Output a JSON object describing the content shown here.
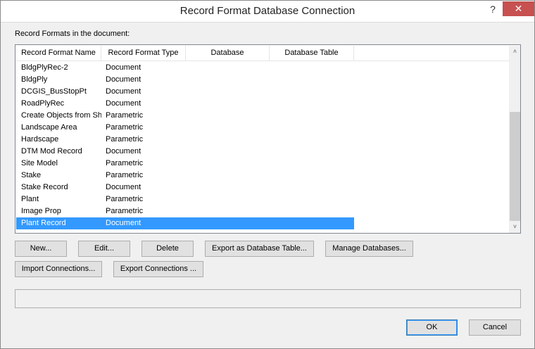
{
  "window": {
    "title": "Record Format Database Connection",
    "help_glyph": "?",
    "close_glyph": "✕"
  },
  "section_label": "Record Formats in the document:",
  "columns": [
    "Record Format Name",
    "Record Format Type",
    "Database",
    "Database Table"
  ],
  "rows": [
    {
      "name": "BldgPlyRec-2",
      "type": "Document",
      "database": "",
      "table": ""
    },
    {
      "name": "BldgPly",
      "type": "Document",
      "database": "",
      "table": ""
    },
    {
      "name": "DCGIS_BusStopPt",
      "type": "Document",
      "database": "",
      "table": ""
    },
    {
      "name": "RoadPlyRec",
      "type": "Document",
      "database": "",
      "table": ""
    },
    {
      "name": "Create Objects from Sh",
      "type": "Parametric",
      "database": "",
      "table": ""
    },
    {
      "name": "Landscape Area",
      "type": "Parametric",
      "database": "",
      "table": ""
    },
    {
      "name": "Hardscape",
      "type": "Parametric",
      "database": "",
      "table": ""
    },
    {
      "name": "DTM Mod Record",
      "type": "Document",
      "database": "",
      "table": ""
    },
    {
      "name": "Site Model",
      "type": "Parametric",
      "database": "",
      "table": ""
    },
    {
      "name": "Stake",
      "type": "Parametric",
      "database": "",
      "table": ""
    },
    {
      "name": "Stake Record",
      "type": "Document",
      "database": "",
      "table": ""
    },
    {
      "name": "Plant",
      "type": "Parametric",
      "database": "",
      "table": ""
    },
    {
      "name": "Image Prop",
      "type": "Parametric",
      "database": "",
      "table": ""
    },
    {
      "name": "Plant Record",
      "type": "Document",
      "database": "",
      "table": "",
      "selected": true
    }
  ],
  "scrollbar": {
    "up_glyph": "˄",
    "down_glyph": "˅"
  },
  "buttons": {
    "new": "New...",
    "edit": "Edit...",
    "delete": "Delete",
    "export_table": "Export as Database Table...",
    "manage": "Manage Databases...",
    "import_conn": "Import Connections...",
    "export_conn": "Export Connections ...",
    "ok": "OK",
    "cancel": "Cancel"
  },
  "status_text": "",
  "colors": {
    "selection": "#3399ff",
    "close": "#c75050"
  }
}
